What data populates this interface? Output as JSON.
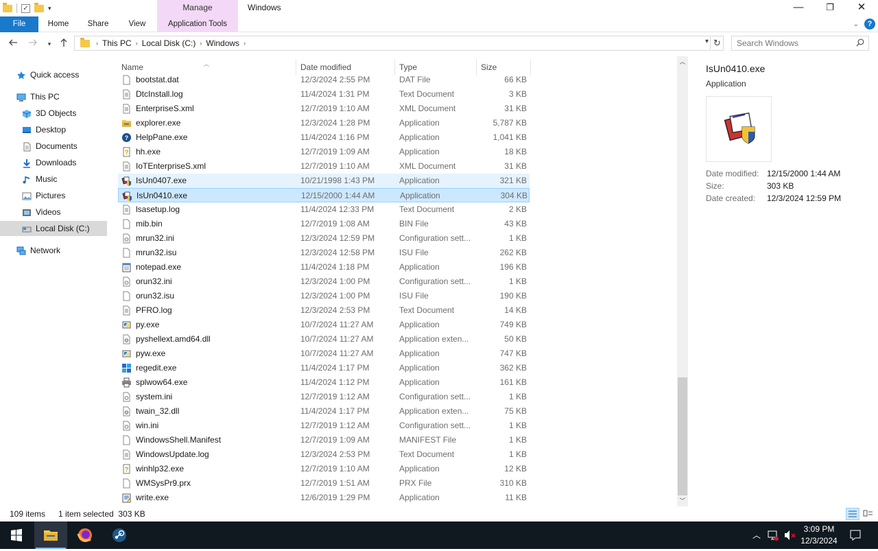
{
  "window": {
    "title": "Windows",
    "contextual_group": "Manage",
    "controls": {
      "minimize": "—",
      "maximize": "❐",
      "close": "✕"
    }
  },
  "ribbon": {
    "tabs": [
      "File",
      "Home",
      "Share",
      "View",
      "Application Tools"
    ]
  },
  "address": {
    "crumbs": [
      "This PC",
      "Local Disk (C:)",
      "Windows"
    ]
  },
  "search": {
    "placeholder": "Search Windows"
  },
  "nav_pane": {
    "items": [
      {
        "label": "Quick access",
        "icon": "star-icon"
      },
      {
        "label": "This PC",
        "icon": "computer-icon"
      },
      {
        "label": "3D Objects",
        "icon": "cube-icon"
      },
      {
        "label": "Desktop",
        "icon": "desktop-icon"
      },
      {
        "label": "Documents",
        "icon": "documents-icon"
      },
      {
        "label": "Downloads",
        "icon": "download-icon"
      },
      {
        "label": "Music",
        "icon": "music-icon"
      },
      {
        "label": "Pictures",
        "icon": "pictures-icon"
      },
      {
        "label": "Videos",
        "icon": "videos-icon"
      },
      {
        "label": "Local Disk (C:)",
        "icon": "drive-icon"
      },
      {
        "label": "Network",
        "icon": "network-icon"
      }
    ]
  },
  "columns": [
    "Name",
    "Date modified",
    "Type",
    "Size"
  ],
  "files": [
    {
      "name": "bootstat.dat",
      "date": "12/3/2024 2:55 PM",
      "type": "DAT File",
      "size": "66 KB",
      "icon": "file-icon"
    },
    {
      "name": "DtcInstall.log",
      "date": "11/4/2024 1:31 PM",
      "type": "Text Document",
      "size": "3 KB",
      "icon": "text-file-icon"
    },
    {
      "name": "EnterpriseS.xml",
      "date": "12/7/2019 1:10 AM",
      "type": "XML Document",
      "size": "31 KB",
      "icon": "text-file-icon"
    },
    {
      "name": "explorer.exe",
      "date": "12/3/2024 1:28 PM",
      "type": "Application",
      "size": "5,787 KB",
      "icon": "explorer-icon"
    },
    {
      "name": "HelpPane.exe",
      "date": "11/4/2024 1:16 PM",
      "type": "Application",
      "size": "1,041 KB",
      "icon": "help-icon"
    },
    {
      "name": "hh.exe",
      "date": "12/7/2019 1:09 AM",
      "type": "Application",
      "size": "18 KB",
      "icon": "help-doc-icon"
    },
    {
      "name": "IoTEnterpriseS.xml",
      "date": "12/7/2019 1:10 AM",
      "type": "XML Document",
      "size": "31 KB",
      "icon": "text-file-icon"
    },
    {
      "name": "IsUn0407.exe",
      "date": "10/21/1998 1:43 PM",
      "type": "Application",
      "size": "321 KB",
      "icon": "uninstaller-icon"
    },
    {
      "name": "IsUn0410.exe",
      "date": "12/15/2000 1:44 AM",
      "type": "Application",
      "size": "304 KB",
      "icon": "uninstaller-icon"
    },
    {
      "name": "lsasetup.log",
      "date": "11/4/2024 12:33 PM",
      "type": "Text Document",
      "size": "2 KB",
      "icon": "text-file-icon"
    },
    {
      "name": "mib.bin",
      "date": "12/7/2019 1:08 AM",
      "type": "BIN File",
      "size": "43 KB",
      "icon": "file-icon"
    },
    {
      "name": "mrun32.ini",
      "date": "12/3/2024 12:59 PM",
      "type": "Configuration sett...",
      "size": "1 KB",
      "icon": "config-file-icon"
    },
    {
      "name": "mrun32.isu",
      "date": "12/3/2024 12:58 PM",
      "type": "ISU File",
      "size": "262 KB",
      "icon": "file-icon"
    },
    {
      "name": "notepad.exe",
      "date": "11/4/2024 1:18 PM",
      "type": "Application",
      "size": "196 KB",
      "icon": "notepad-icon"
    },
    {
      "name": "orun32.ini",
      "date": "12/3/2024 1:00 PM",
      "type": "Configuration sett...",
      "size": "1 KB",
      "icon": "config-file-icon"
    },
    {
      "name": "orun32.isu",
      "date": "12/3/2024 1:00 PM",
      "type": "ISU File",
      "size": "190 KB",
      "icon": "file-icon"
    },
    {
      "name": "PFRO.log",
      "date": "12/3/2024 2:53 PM",
      "type": "Text Document",
      "size": "14 KB",
      "icon": "text-file-icon"
    },
    {
      "name": "py.exe",
      "date": "10/7/2024 11:27 AM",
      "type": "Application",
      "size": "749 KB",
      "icon": "python-icon"
    },
    {
      "name": "pyshellext.amd64.dll",
      "date": "10/7/2024 11:27 AM",
      "type": "Application exten...",
      "size": "50 KB",
      "icon": "dll-icon"
    },
    {
      "name": "pyw.exe",
      "date": "10/7/2024 11:27 AM",
      "type": "Application",
      "size": "747 KB",
      "icon": "python-icon"
    },
    {
      "name": "regedit.exe",
      "date": "11/4/2024 1:17 PM",
      "type": "Application",
      "size": "362 KB",
      "icon": "regedit-icon"
    },
    {
      "name": "splwow64.exe",
      "date": "11/4/2024 1:12 PM",
      "type": "Application",
      "size": "161 KB",
      "icon": "printer-icon"
    },
    {
      "name": "system.ini",
      "date": "12/7/2019 1:12 AM",
      "type": "Configuration sett...",
      "size": "1 KB",
      "icon": "config-file-icon"
    },
    {
      "name": "twain_32.dll",
      "date": "11/4/2024 1:17 PM",
      "type": "Application exten...",
      "size": "75 KB",
      "icon": "dll-icon"
    },
    {
      "name": "win.ini",
      "date": "12/7/2019 1:12 AM",
      "type": "Configuration sett...",
      "size": "1 KB",
      "icon": "config-file-icon"
    },
    {
      "name": "WindowsShell.Manifest",
      "date": "12/7/2019 1:09 AM",
      "type": "MANIFEST File",
      "size": "1 KB",
      "icon": "file-icon"
    },
    {
      "name": "WindowsUpdate.log",
      "date": "12/3/2024 2:53 PM",
      "type": "Text Document",
      "size": "1 KB",
      "icon": "text-file-icon"
    },
    {
      "name": "winhlp32.exe",
      "date": "12/7/2019 1:10 AM",
      "type": "Application",
      "size": "12 KB",
      "icon": "help-doc-icon"
    },
    {
      "name": "WMSysPr9.prx",
      "date": "12/7/2019 1:51 AM",
      "type": "PRX File",
      "size": "310 KB",
      "icon": "file-icon"
    },
    {
      "name": "write.exe",
      "date": "12/6/2019 1:29 PM",
      "type": "Application",
      "size": "11 KB",
      "icon": "wordpad-icon"
    }
  ],
  "hovered_file": "IsUn0407.exe",
  "selected_file": "IsUn0410.exe",
  "preview": {
    "name": "IsUn0410.exe",
    "type": "Application",
    "props": [
      {
        "label": "Date modified:",
        "value": "12/15/2000 1:44 AM"
      },
      {
        "label": "Size:",
        "value": "303 KB"
      },
      {
        "label": "Date created:",
        "value": "12/3/2024 12:59 PM"
      }
    ]
  },
  "status": {
    "count": "109 items",
    "selection": "1 item selected  303 KB"
  },
  "taskbar": {
    "apps": [
      "start-icon",
      "file-explorer-icon",
      "firefox-icon",
      "steam-icon"
    ],
    "time": "3:09 PM",
    "date": "12/3/2024"
  },
  "colors": {
    "accent": "#1979ca",
    "selection": "#cce8ff",
    "hover": "#e5f3ff",
    "manage_tab": "#f3d9f7",
    "taskbar": "#101820"
  }
}
